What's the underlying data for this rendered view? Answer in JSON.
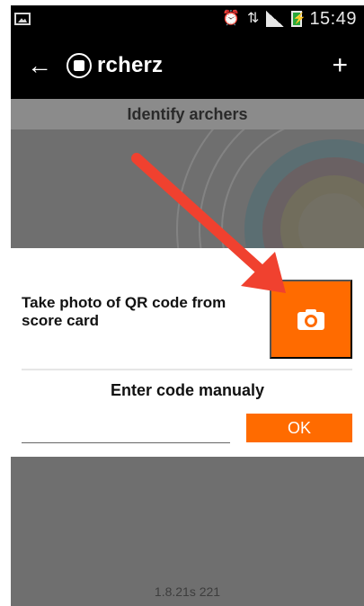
{
  "status_bar": {
    "time": "15:49",
    "icons": [
      "image-icon",
      "alarm-icon",
      "data-icon",
      "signal-icon",
      "battery-charging-icon"
    ]
  },
  "app_bar": {
    "logo_text": "rcherz",
    "back_icon": "back-arrow-icon",
    "add_icon": "add-icon"
  },
  "screen": {
    "header_title": "Identify archers",
    "version": "1.8.21s 221"
  },
  "dialog": {
    "qr_prompt": "Take photo of QR code from score card",
    "manual_title": "Enter code manualy",
    "code_input_value": "",
    "ok_label": "OK"
  },
  "colors": {
    "accent": "#ff6b00",
    "annotation_arrow": "#f0412f",
    "overlay": "#6f6f6f"
  }
}
